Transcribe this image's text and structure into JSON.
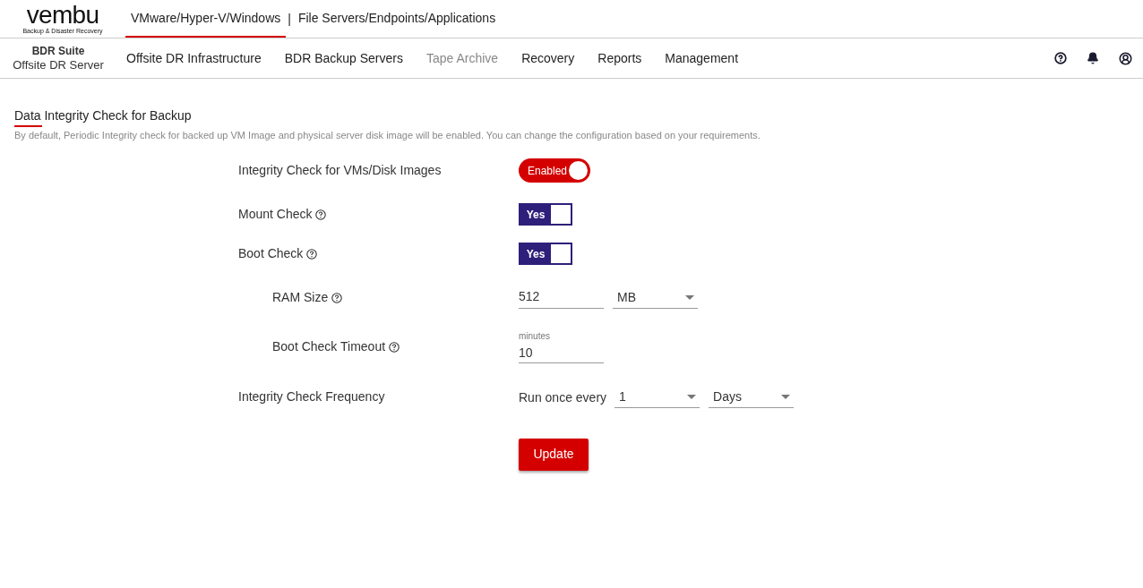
{
  "logo": {
    "name": "vembu",
    "tagline": "Backup & Disaster Recovery"
  },
  "tab_separator": "|",
  "top_tabs": [
    {
      "label": "VMware/Hyper-V/Windows",
      "selected": true
    },
    {
      "label": "File Servers/Endpoints/Applications",
      "selected": false
    }
  ],
  "product": {
    "suite": "BDR Suite",
    "name": "Offsite DR Server"
  },
  "nav": [
    {
      "label": "Offsite DR Infrastructure",
      "disabled": false
    },
    {
      "label": "BDR Backup Servers",
      "disabled": false
    },
    {
      "label": "Tape Archive",
      "disabled": true
    },
    {
      "label": "Recovery",
      "disabled": false
    },
    {
      "label": "Reports",
      "disabled": false
    },
    {
      "label": "Management",
      "disabled": false
    }
  ],
  "page": {
    "title": "Data Integrity Check for Backup",
    "description": "By default, Periodic Integrity check for backed up VM Image and physical server disk image will be enabled. You can change the configuration based on your requirements."
  },
  "settings": [
    {
      "kind": "switch",
      "label": "Integrity Check for VMs/Disk Images",
      "help": false,
      "on": true,
      "text": "Enabled"
    },
    {
      "kind": "yesno",
      "label": "Mount Check",
      "help": true,
      "on": true,
      "text": "Yes"
    },
    {
      "kind": "yesno",
      "label": "Boot Check",
      "help": true,
      "on": true,
      "text": "Yes",
      "children": [
        {
          "kind": "size",
          "label": "RAM Size",
          "help": true,
          "value": "512",
          "unit": "MB"
        },
        {
          "kind": "number",
          "label": "Boot Check Timeout",
          "help": true,
          "caption": "minutes",
          "value": "10"
        }
      ]
    },
    {
      "kind": "frequency",
      "label": "Integrity Check Frequency",
      "help": false,
      "prefix": "Run once every",
      "value": "1",
      "unit": "Days"
    }
  ],
  "update_button": "Update"
}
